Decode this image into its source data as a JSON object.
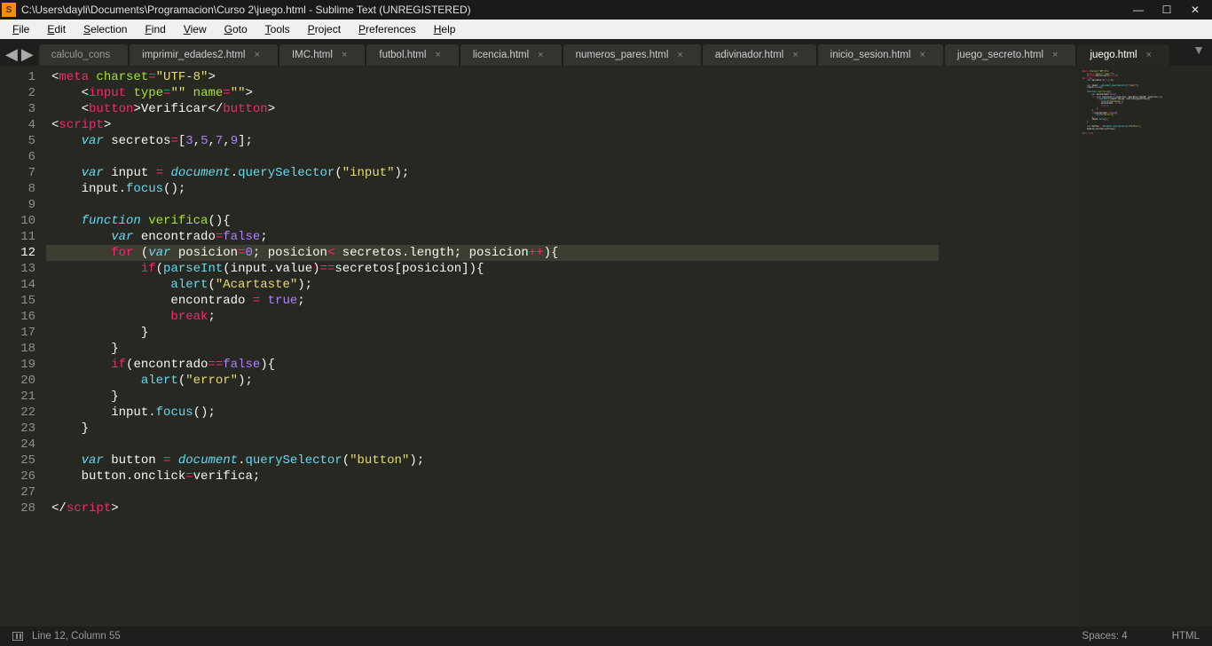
{
  "window": {
    "title": "C:\\Users\\dayli\\Documents\\Programacion\\Curso 2\\juego.html - Sublime Text (UNREGISTERED)",
    "appIconLetter": "S"
  },
  "menu": {
    "items": [
      "File",
      "Edit",
      "Selection",
      "Find",
      "View",
      "Goto",
      "Tools",
      "Project",
      "Preferences",
      "Help"
    ]
  },
  "tabs": {
    "left_truncated": "calculo_cons",
    "items": [
      "imprimir_edades2.html",
      "IMC.html",
      "futbol.html",
      "licencia.html",
      "numeros_pares.html",
      "adivinador.html",
      "inicio_sesion.html",
      "juego_secreto.html",
      "juego.html"
    ],
    "active_index": 8
  },
  "editor": {
    "active_line": 12,
    "lines": [
      {
        "n": 1,
        "html": "<span class='c-punc'>&lt;</span><span class='c-tag'>meta</span> <span class='c-attr'>charset</span><span class='c-op'>=</span><span class='c-str'>&quot;UTF-8&quot;</span><span class='c-punc'>&gt;</span>"
      },
      {
        "n": 2,
        "html": "    <span class='c-punc'>&lt;</span><span class='c-tag'>input</span> <span class='c-attr'>type</span><span class='c-op'>=</span><span class='c-str'>&quot;&quot;</span> <span class='c-attr'>name</span><span class='c-op'>=</span><span class='c-str'>&quot;&quot;</span><span class='c-punc'>&gt;</span>"
      },
      {
        "n": 3,
        "html": "    <span class='c-punc'>&lt;</span><span class='c-tag'>button</span><span class='c-punc'>&gt;</span><span class='c-text'>Verificar</span><span class='c-punc'>&lt;/</span><span class='c-tag'>button</span><span class='c-punc'>&gt;</span>"
      },
      {
        "n": 4,
        "html": "<span class='c-punc'>&lt;</span><span class='c-tag'>script</span><span class='c-punc'>&gt;</span>"
      },
      {
        "n": 5,
        "html": "    <span class='c-stor'>var</span> <span class='c-white'>secretos</span><span class='c-op'>=</span><span class='c-punc'>[</span><span class='c-num'>3</span><span class='c-punc'>,</span><span class='c-num'>5</span><span class='c-punc'>,</span><span class='c-num'>7</span><span class='c-punc'>,</span><span class='c-num'>9</span><span class='c-punc'>];</span>"
      },
      {
        "n": 6,
        "html": ""
      },
      {
        "n": 7,
        "html": "    <span class='c-stor'>var</span> <span class='c-white'>input </span><span class='c-op'>=</span><span class='c-white'> </span><span class='c-obj'>document</span><span class='c-punc'>.</span><span class='c-call'>querySelector</span><span class='c-punc'>(</span><span class='c-str'>&quot;input&quot;</span><span class='c-punc'>);</span>"
      },
      {
        "n": 8,
        "html": "    <span class='c-white'>input</span><span class='c-punc'>.</span><span class='c-call'>focus</span><span class='c-punc'>();</span>"
      },
      {
        "n": 9,
        "html": ""
      },
      {
        "n": 10,
        "html": "    <span class='c-stor'>function</span> <span class='c-fn'>verifica</span><span class='c-punc'>(){</span>"
      },
      {
        "n": 11,
        "html": "        <span class='c-stor'>var</span> <span class='c-white'>encontrado</span><span class='c-op'>=</span><span class='c-const'>false</span><span class='c-punc'>;</span>"
      },
      {
        "n": 12,
        "html": "        <span class='c-kw2'>for</span> <span class='c-punc'>(</span><span class='c-stor'>var</span> <span class='c-white'>posicion</span><span class='c-op'>=</span><span class='c-num'>0</span><span class='c-punc'>; </span><span class='c-white'>posicion</span><span class='c-op'>&lt;</span><span class='c-white'> secretos</span><span class='c-punc'>.</span><span class='c-white'>length</span><span class='c-punc'>; </span><span class='c-white'>posicion</span><span class='c-op'>++</span><span class='c-punc'>){</span>"
      },
      {
        "n": 13,
        "html": "            <span class='c-kw2'>if</span><span class='c-punc'>(</span><span class='c-call'>parseInt</span><span class='c-punc'>(</span><span class='c-white'>input</span><span class='c-punc'>.</span><span class='c-white'>value</span><span class='c-punc'>)</span><span class='c-op'>==</span><span class='c-white'>secretos</span><span class='c-punc'>[</span><span class='c-white'>posicion</span><span class='c-punc'>]){</span>"
      },
      {
        "n": 14,
        "html": "                <span class='c-call'>alert</span><span class='c-punc'>(</span><span class='c-str'>&quot;Acartaste&quot;</span><span class='c-punc'>);</span>"
      },
      {
        "n": 15,
        "html": "                <span class='c-white'>encontrado </span><span class='c-op'>=</span><span class='c-white'> </span><span class='c-const'>true</span><span class='c-punc'>;</span>"
      },
      {
        "n": 16,
        "html": "                <span class='c-kw2'>break</span><span class='c-punc'>;</span>"
      },
      {
        "n": 17,
        "html": "            <span class='c-punc'>}</span>"
      },
      {
        "n": 18,
        "html": "        <span class='c-punc'>}</span>"
      },
      {
        "n": 19,
        "html": "        <span class='c-kw2'>if</span><span class='c-punc'>(</span><span class='c-white'>encontrado</span><span class='c-op'>==</span><span class='c-const'>false</span><span class='c-punc'>){</span>"
      },
      {
        "n": 20,
        "html": "            <span class='c-call'>alert</span><span class='c-punc'>(</span><span class='c-str'>&quot;error&quot;</span><span class='c-punc'>);</span>"
      },
      {
        "n": 21,
        "html": "        <span class='c-punc'>}</span>"
      },
      {
        "n": 22,
        "html": "        <span class='c-white'>input</span><span class='c-punc'>.</span><span class='c-call'>focus</span><span class='c-punc'>();</span>"
      },
      {
        "n": 23,
        "html": "    <span class='c-punc'>}</span>"
      },
      {
        "n": 24,
        "html": ""
      },
      {
        "n": 25,
        "html": "    <span class='c-stor'>var</span> <span class='c-white'>button </span><span class='c-op'>=</span><span class='c-white'> </span><span class='c-obj'>document</span><span class='c-punc'>.</span><span class='c-call'>querySelector</span><span class='c-punc'>(</span><span class='c-str'>&quot;button&quot;</span><span class='c-punc'>);</span>"
      },
      {
        "n": 26,
        "html": "    <span class='c-white'>button</span><span class='c-punc'>.</span><span class='c-white'>onclick</span><span class='c-op'>=</span><span class='c-white'>verifica</span><span class='c-punc'>;</span>"
      },
      {
        "n": 27,
        "html": ""
      },
      {
        "n": 28,
        "html": "<span class='c-punc'>&lt;/</span><span class='c-tag'>script</span><span class='c-punc'>&gt;</span>"
      }
    ]
  },
  "statusbar": {
    "position": "Line 12, Column 55",
    "spaces": "Spaces: 4",
    "syntax": "HTML"
  },
  "winControls": {
    "min": "—",
    "max": "☐",
    "close": "✕"
  }
}
